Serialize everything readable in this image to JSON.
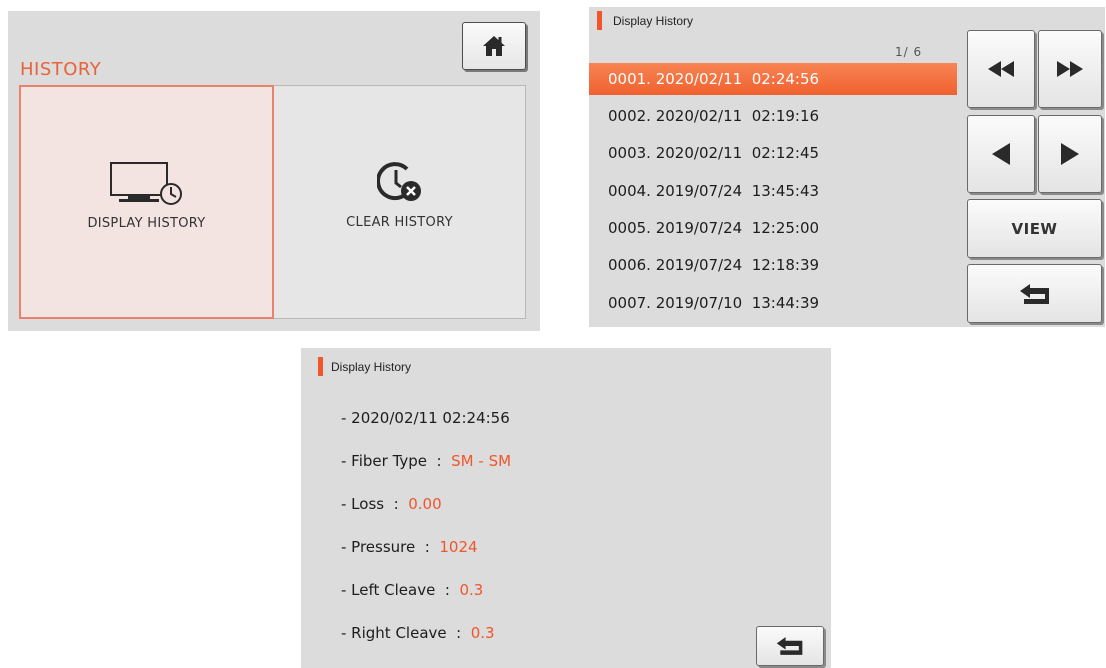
{
  "colors": {
    "accent": "#f0562a",
    "title_accent": "#e8633a",
    "screen_background": "#dcdcdc",
    "selected_row": "#f26a39",
    "selected_panel": "#f4e4e1"
  },
  "history_menu": {
    "title": "HISTORY",
    "home_icon": "home-icon",
    "options": [
      {
        "label": "DISPLAY HISTORY",
        "icon": "monitor-clock-icon",
        "selected": true
      },
      {
        "label": "CLEAR HISTORY",
        "icon": "clock-delete-icon",
        "selected": false
      }
    ]
  },
  "history_list": {
    "header": "Display History",
    "pager": "1/  6",
    "rows": [
      {
        "text": "0001. 2020/02/11  02:24:56",
        "selected": true
      },
      {
        "text": "0002. 2020/02/11  02:19:16",
        "selected": false
      },
      {
        "text": "0003. 2020/02/11  02:12:45",
        "selected": false
      },
      {
        "text": "0004. 2019/07/24  13:45:43",
        "selected": false
      },
      {
        "text": "0005. 2019/07/24  12:25:00",
        "selected": false
      },
      {
        "text": "0006. 2019/07/24  12:18:39",
        "selected": false
      },
      {
        "text": "0007. 2019/07/10  13:44:39",
        "selected": false
      }
    ],
    "buttons": {
      "first_page_icon": "double-left-arrow-icon",
      "last_page_icon": "double-right-arrow-icon",
      "prev_icon": "left-arrow-icon",
      "next_icon": "right-arrow-icon",
      "view_label": "VIEW",
      "back_icon": "return-arrow-icon"
    }
  },
  "history_detail": {
    "header": "Display History",
    "datetime": "- 2020/02/11 02:24:56",
    "fields": [
      {
        "label": "- Fiber Type  :  ",
        "value": "SM - SM"
      },
      {
        "label": "- Loss  :  ",
        "value": "0.00"
      },
      {
        "label": "- Pressure  :  ",
        "value": "1024"
      },
      {
        "label": "- Left Cleave  :  ",
        "value": "0.3"
      },
      {
        "label": "- Right Cleave  :  ",
        "value": "0.3"
      }
    ],
    "back_icon": "return-arrow-icon"
  }
}
